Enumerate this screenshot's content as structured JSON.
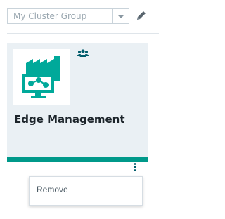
{
  "toolbar": {
    "cluster_group": "My Cluster Group"
  },
  "app_card": {
    "title": "Edge Management",
    "icon": "factory-monitor-icon",
    "group_icon": "users-icon",
    "accent": "#00998a"
  },
  "context_menu": {
    "items": [
      {
        "label": "Remove"
      }
    ]
  }
}
